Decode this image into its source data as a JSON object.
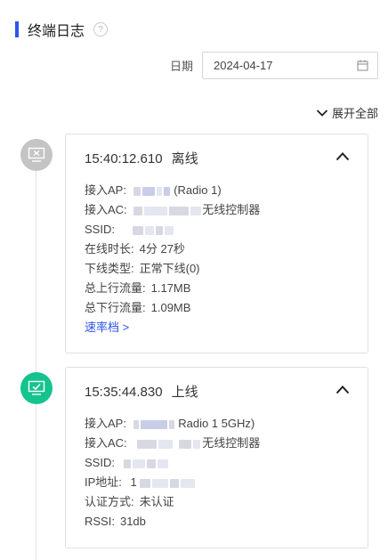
{
  "header": {
    "title": "终端日志",
    "help": "?"
  },
  "date": {
    "label": "日期",
    "value": "2024-04-17"
  },
  "expand_all": "展开全部",
  "events": [
    {
      "time": "15:40:12.610",
      "status": "离线",
      "rows": [
        {
          "label": "接入AP:",
          "tail": "(Radio 1)"
        },
        {
          "label": "接入AC:",
          "tail": "无线控制器"
        },
        {
          "label": "SSID:",
          "tail": ""
        },
        {
          "label": "在线时长:",
          "value": "4分 27秒"
        },
        {
          "label": "下线类型:",
          "value": "正常下线(0)"
        },
        {
          "label": "总上行流量:",
          "value": "1.17MB"
        },
        {
          "label": "总下行流量:",
          "value": "1.09MB"
        }
      ],
      "link": "速率档 >"
    },
    {
      "time": "15:35:44.830",
      "status": "上线",
      "rows": [
        {
          "label": "接入AP:",
          "tail": "Radio 1 5GHz)"
        },
        {
          "label": "接入AC:",
          "tail": "无线控制器"
        },
        {
          "label": "SSID:",
          "tail": ""
        },
        {
          "label": "IP地址:",
          "tail": "1"
        },
        {
          "label": "认证方式:",
          "value": "未认证"
        },
        {
          "label": "RSSI:",
          "value": "31db"
        }
      ]
    }
  ]
}
